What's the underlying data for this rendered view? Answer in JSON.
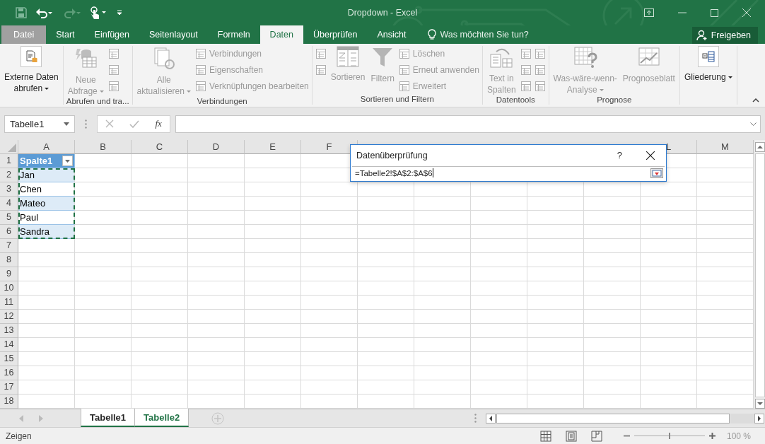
{
  "window": {
    "title": "Dropdown - Excel"
  },
  "tabs": [
    {
      "label": "Datei",
      "kind": "file",
      "selected": false
    },
    {
      "label": "Start",
      "kind": "tab",
      "selected": false
    },
    {
      "label": "Einfügen",
      "kind": "tab",
      "selected": false
    },
    {
      "label": "Seitenlayout",
      "kind": "tab",
      "selected": false
    },
    {
      "label": "Formeln",
      "kind": "tab",
      "selected": false
    },
    {
      "label": "Daten",
      "kind": "tab",
      "selected": true
    },
    {
      "label": "Überprüfen",
      "kind": "tab",
      "selected": false
    },
    {
      "label": "Ansicht",
      "kind": "tab",
      "selected": false
    }
  ],
  "tell_me": {
    "placeholder": "Was möchten Sie tun?"
  },
  "share_button": "Freigeben",
  "ribbon": {
    "groups": [
      {
        "columns": [
          {
            "kind": "large",
            "lines": [
              "Externe Daten",
              "abrufen"
            ],
            "menu": true,
            "disabled": false
          }
        ]
      },
      {
        "label": "Abrufen und tra...",
        "columns": [
          {
            "kind": "large",
            "lines": [
              "Neue",
              "Abfrage"
            ],
            "menu": true,
            "disabled": true
          },
          {
            "kind": "stack",
            "items": [
              {
                "disabled": true
              },
              {
                "disabled": true
              },
              {
                "disabled": true
              }
            ]
          }
        ]
      },
      {
        "label": "Verbindungen",
        "columns": [
          {
            "kind": "large",
            "lines": [
              "Alle",
              "aktualisieren"
            ],
            "menu": true,
            "disabled": true
          },
          {
            "kind": "stack",
            "items": [
              {
                "label": "Verbindungen",
                "disabled": true
              },
              {
                "label": "Eigenschaften",
                "disabled": true
              },
              {
                "label": "Verknüpfungen bearbeiten",
                "disabled": true
              }
            ]
          }
        ]
      },
      {
        "label": "Sortieren und Filtern",
        "columns": [
          {
            "kind": "stack",
            "items": [
              {
                "disabled": true
              },
              {
                "disabled": true
              }
            ]
          },
          {
            "kind": "large",
            "lines": [
              "Sortieren"
            ],
            "menu": false,
            "disabled": true
          },
          {
            "kind": "large",
            "lines": [
              "Filtern"
            ],
            "menu": false,
            "disabled": true
          },
          {
            "kind": "stack",
            "items": [
              {
                "label": "Löschen",
                "disabled": true
              },
              {
                "label": "Erneut anwenden",
                "disabled": true
              },
              {
                "label": "Erweitert",
                "disabled": true
              }
            ]
          }
        ]
      },
      {
        "label": "Datentools",
        "columns": [
          {
            "kind": "large",
            "lines": [
              "Text in",
              "Spalten"
            ],
            "menu": false,
            "disabled": true
          },
          {
            "kind": "stack",
            "items": [
              {
                "disabled": true
              },
              {
                "disabled": true
              },
              {
                "disabled": true
              }
            ]
          },
          {
            "kind": "stack",
            "items": [
              {
                "disabled": true
              },
              {
                "disabled": true
              },
              {
                "disabled": true
              }
            ]
          }
        ]
      },
      {
        "label": "Prognose",
        "columns": [
          {
            "kind": "large",
            "lines": [
              "Was-wäre-wenn-",
              "Analyse"
            ],
            "menu": true,
            "disabled": true
          },
          {
            "kind": "large",
            "lines": [
              "Prognoseblatt"
            ],
            "menu": false,
            "disabled": true
          }
        ]
      },
      {
        "columns": [
          {
            "kind": "large",
            "lines": [
              "Gliederung"
            ],
            "menu": true,
            "disabled": false
          }
        ]
      }
    ]
  },
  "formula_bar": {
    "name_box": "Tabelle1",
    "function_button": "fx"
  },
  "sheet": {
    "column_headers_left": [
      "A",
      "B",
      "C",
      "D",
      "E",
      "F"
    ],
    "column_headers_right": [
      "L",
      "M"
    ],
    "row_numbers": [
      "1",
      "2",
      "3",
      "4",
      "5",
      "6",
      "7",
      "8",
      "9",
      "10",
      "11",
      "12",
      "13",
      "14",
      "15",
      "16",
      "17",
      "18"
    ],
    "table": {
      "header": "Spalte1",
      "rows": [
        "Jan",
        "Chen",
        "Mateo",
        "Paul",
        "Sandra"
      ]
    }
  },
  "dialog": {
    "title": "Datenüberprüfung",
    "help": "?",
    "value": "=Tabelle2!$A$2:$A$6"
  },
  "sheet_tabs": [
    {
      "label": "Tabelle1",
      "grouped": true,
      "selected": false
    },
    {
      "label": "Tabelle2",
      "grouped": true,
      "selected": true
    }
  ],
  "status_bar": {
    "text": "Zeigen",
    "zoom": {
      "level": 0.5,
      "reading": "100 %"
    }
  }
}
